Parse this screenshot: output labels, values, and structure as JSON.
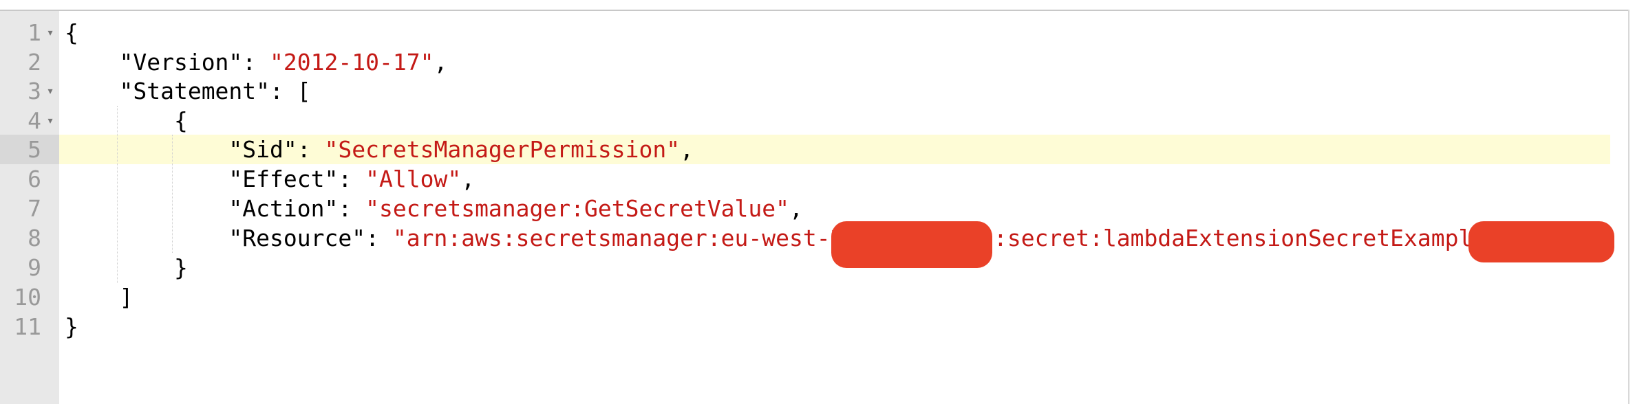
{
  "editor": {
    "lines": [
      {
        "num": "1",
        "fold": "▾",
        "indent": "",
        "key": "",
        "sep": "",
        "value": "",
        "tail": "{"
      },
      {
        "num": "2",
        "fold": "",
        "indent": "    ",
        "key": "\"Version\"",
        "sep": ": ",
        "value": "\"2012-10-17\"",
        "tail": ","
      },
      {
        "num": "3",
        "fold": "▾",
        "indent": "    ",
        "key": "\"Statement\"",
        "sep": ": ",
        "value": "",
        "tail": "["
      },
      {
        "num": "4",
        "fold": "▾",
        "indent": "        ",
        "key": "",
        "sep": "",
        "value": "",
        "tail": "{"
      },
      {
        "num": "5",
        "fold": "",
        "indent": "            ",
        "key": "\"Sid\"",
        "sep": ": ",
        "value": "\"SecretsManagerPermission\"",
        "tail": ","
      },
      {
        "num": "6",
        "fold": "",
        "indent": "            ",
        "key": "\"Effect\"",
        "sep": ": ",
        "value": "\"Allow\"",
        "tail": ","
      },
      {
        "num": "7",
        "fold": "",
        "indent": "            ",
        "key": "\"Action\"",
        "sep": ": ",
        "value": "\"secretsmanager:GetSecretValue\"",
        "tail": ","
      },
      {
        "num": "8",
        "fold": "",
        "indent": "            ",
        "key": "\"Resource\"",
        "sep": ": ",
        "value": "",
        "tail": ""
      },
      {
        "num": "9",
        "fold": "",
        "indent": "        ",
        "key": "",
        "sep": "",
        "value": "",
        "tail": "}"
      },
      {
        "num": "10",
        "fold": "",
        "indent": "    ",
        "key": "",
        "sep": "",
        "value": "",
        "tail": "]"
      },
      {
        "num": "11",
        "fold": "",
        "indent": "",
        "key": "",
        "sep": "",
        "value": "",
        "tail": "}"
      }
    ],
    "resource_value_part1": "\"arn:aws:secretsmanager:eu-west-2:",
    "resource_value_part2": ":secret:lambdaExtensionSecretExample",
    "active_line": "5",
    "colors": {
      "string": "#c41a16",
      "redaction": "#ea4128",
      "active_line_bg": "#fefcd6",
      "gutter_bg": "#e8e8e8"
    }
  }
}
